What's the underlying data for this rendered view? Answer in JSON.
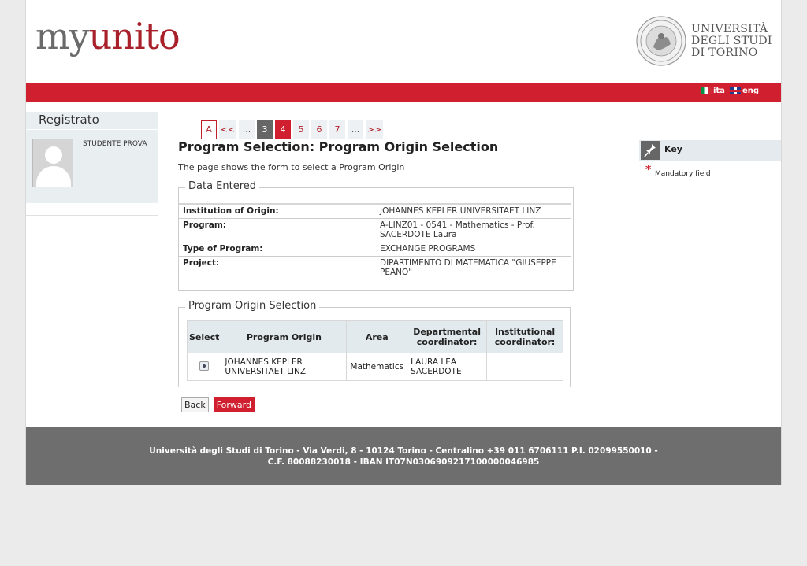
{
  "header": {
    "logo_my": "my",
    "logo_unito": "unito",
    "university": [
      "UNIVERSITÀ",
      "DEGLI STUDI",
      "DI TORINO"
    ]
  },
  "lang": {
    "ita": "ita",
    "eng": "eng"
  },
  "sidebar": {
    "title": "Registrato",
    "user": "STUDENTE PROVA"
  },
  "pager": [
    {
      "label": "A",
      "kind": "first"
    },
    {
      "label": "<<",
      "kind": "arrow"
    },
    {
      "label": "...",
      "kind": "dots"
    },
    {
      "label": "3",
      "kind": "dark"
    },
    {
      "label": "4",
      "kind": "red"
    },
    {
      "label": "5",
      "kind": "normal"
    },
    {
      "label": "6",
      "kind": "normal"
    },
    {
      "label": "7",
      "kind": "normal"
    },
    {
      "label": "...",
      "kind": "dots"
    },
    {
      "label": ">>",
      "kind": "arrow"
    }
  ],
  "main": {
    "title": "Program Selection: Program Origin Selection",
    "intro": "The page shows the form to select a Program Origin",
    "data_entered": {
      "legend": "Data Entered",
      "rows": [
        {
          "key": "Institution of Origin:",
          "value": "JOHANNES KEPLER UNIVERSITAET LINZ"
        },
        {
          "key": "Program:",
          "value": "A-LINZ01 - 0541 - Mathematics - Prof. SACERDOTE Laura"
        },
        {
          "key": "Type of Program:",
          "value": "EXCHANGE PROGRAMS"
        },
        {
          "key": "Project:",
          "value": "DIPARTIMENTO DI MATEMATICA \"GIUSEPPE PEANO\""
        }
      ]
    },
    "origin_selection": {
      "legend": "Program Origin Selection",
      "headers": [
        "Select",
        "Program Origin",
        "Area",
        "Departmental coordinator:",
        "Institutional coordinator:"
      ],
      "rows": [
        {
          "program_origin": "JOHANNES KEPLER UNIVERSITAET LINZ",
          "area": "Mathematics",
          "dept_coordinator": "LAURA LEA SACERDOTE",
          "inst_coordinator": ""
        }
      ]
    },
    "buttons": {
      "back": "Back",
      "forward": "Forward"
    }
  },
  "key": {
    "title": "Key",
    "star": "*",
    "mandatory": "Mandatory field"
  },
  "footer": {
    "line1": "Università degli Studi di Torino - Via Verdi, 8 - 10124 Torino - Centralino +39 011 6706111 P.I. 02099550010 -",
    "line2": "C.F. 80088230018 - IBAN IT07N0306909217100000046985"
  },
  "colors": {
    "brand_red": "#d0202f",
    "logo_red": "#a8202a",
    "footer_gray": "#6e6e6e"
  }
}
